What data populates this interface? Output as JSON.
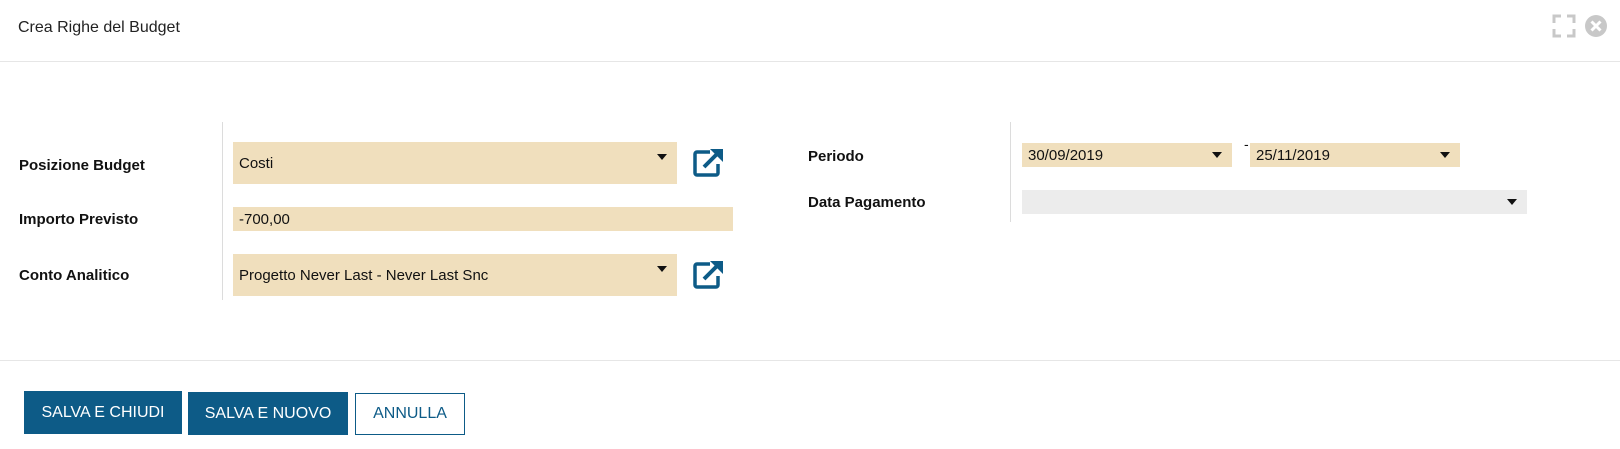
{
  "dialog": {
    "title": "Crea Righe del Budget",
    "accent_color": "#0d5b87",
    "field_color": "#f0dfbd"
  },
  "form": {
    "posizione_budget": {
      "label": "Posizione Budget",
      "value": "Costi"
    },
    "importo_previsto": {
      "label": "Importo Previsto",
      "value": "-700,00"
    },
    "conto_analitico": {
      "label": "Conto Analitico",
      "value": "Progetto Never Last - Never Last Snc"
    },
    "periodo": {
      "label": "Periodo",
      "from": "30/09/2019",
      "separator": "-",
      "to": "25/11/2019"
    },
    "data_pagamento": {
      "label": "Data Pagamento",
      "value": ""
    }
  },
  "buttons": {
    "save_close": "SALVA E CHIUDI",
    "save_new": "SALVA E NUOVO",
    "cancel": "ANNULLA"
  }
}
